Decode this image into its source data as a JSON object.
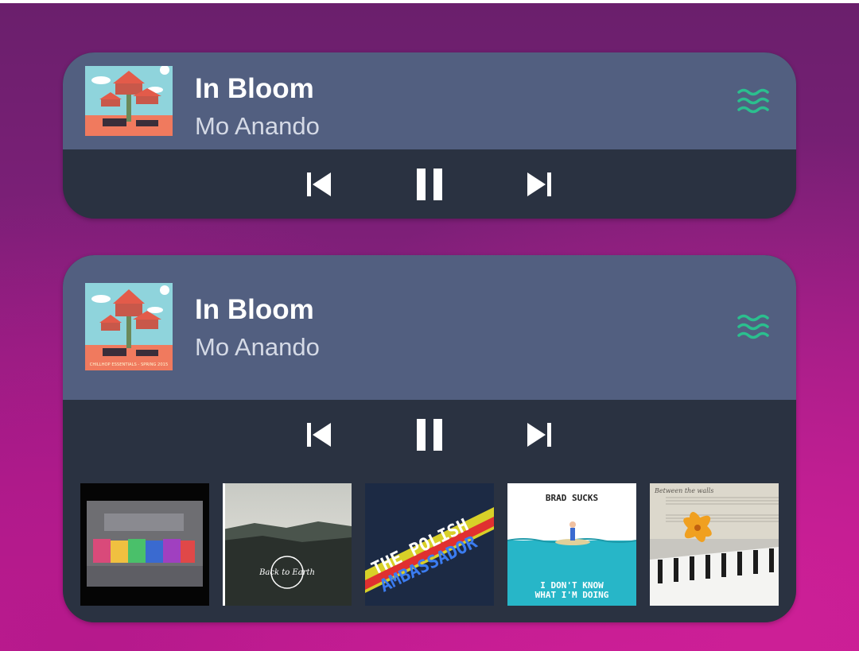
{
  "colors": {
    "header_bg": "#525f80",
    "controls_bg": "#2a3241",
    "accent": "#2bbf8e",
    "title": "#ffffff",
    "artist": "#d5dae6"
  },
  "small_widget": {
    "title": "In Bloom",
    "artist": "Mo Anando",
    "album_art": "treehouse-album-art",
    "controls": [
      "skip-previous-icon",
      "pause-icon",
      "skip-next-icon"
    ],
    "status_icon": "wave-icon"
  },
  "large_widget": {
    "title": "In Bloom",
    "artist": "Mo Anando",
    "album_art": "treehouse-album-art",
    "album_caption": "CHILLHOP ESSENTIALS - SPRING 2015",
    "controls": [
      "skip-previous-icon",
      "pause-icon",
      "skip-next-icon"
    ],
    "status_icon": "wave-icon",
    "recent_albums": [
      {
        "name": "glitch-rainbow-cover"
      },
      {
        "name": "back-to-earth-cover",
        "text": "Back to Earth"
      },
      {
        "name": "the-polish-ambassador-cover",
        "text_1": "THE POLISH",
        "text_2": "AMBASSADOR"
      },
      {
        "name": "brad-sucks-cover",
        "text_top": "BRAD SUCKS",
        "text_bottom_1": "I DON'T KNOW",
        "text_bottom_2": "WHAT I'M DOING"
      },
      {
        "name": "between-the-walls-cover",
        "text": "Between the walls"
      }
    ]
  }
}
